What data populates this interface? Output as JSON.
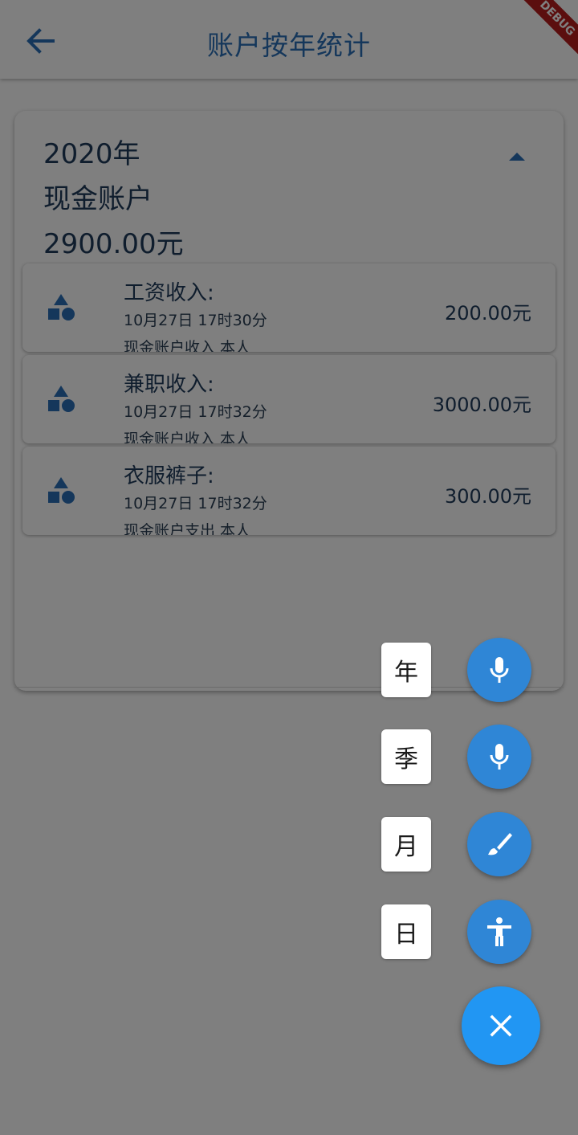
{
  "appbar": {
    "title": "账户按年统计",
    "debug_banner": "DEBUG"
  },
  "year_card": {
    "year": "2020年",
    "account": "现金账户",
    "total": "2900.00元",
    "records": [
      {
        "title": "工资收入:",
        "time": "10月27日 17时30分",
        "sub": "现金账户收入  本人",
        "amount": "200.00元"
      },
      {
        "title": "兼职收入:",
        "time": "10月27日 17时32分",
        "sub": "现金账户收入  本人",
        "amount": "3000.00元"
      },
      {
        "title": "衣服裤子:",
        "time": "10月27日 17时32分",
        "sub": "现金账户支出  本人",
        "amount": "300.00元"
      }
    ]
  },
  "speed_dial": {
    "items": [
      {
        "label": "年",
        "icon": "mic-icon"
      },
      {
        "label": "季",
        "icon": "mic-icon"
      },
      {
        "label": "月",
        "icon": "brush-icon"
      },
      {
        "label": "日",
        "icon": "accessibility-icon"
      }
    ],
    "close_icon": "close-icon"
  },
  "colors": {
    "primary": "#2a6fb6",
    "fab": "#2196f3",
    "dial_button": "#2f86d6",
    "scrim": "rgba(0,0,0,0.5)"
  }
}
